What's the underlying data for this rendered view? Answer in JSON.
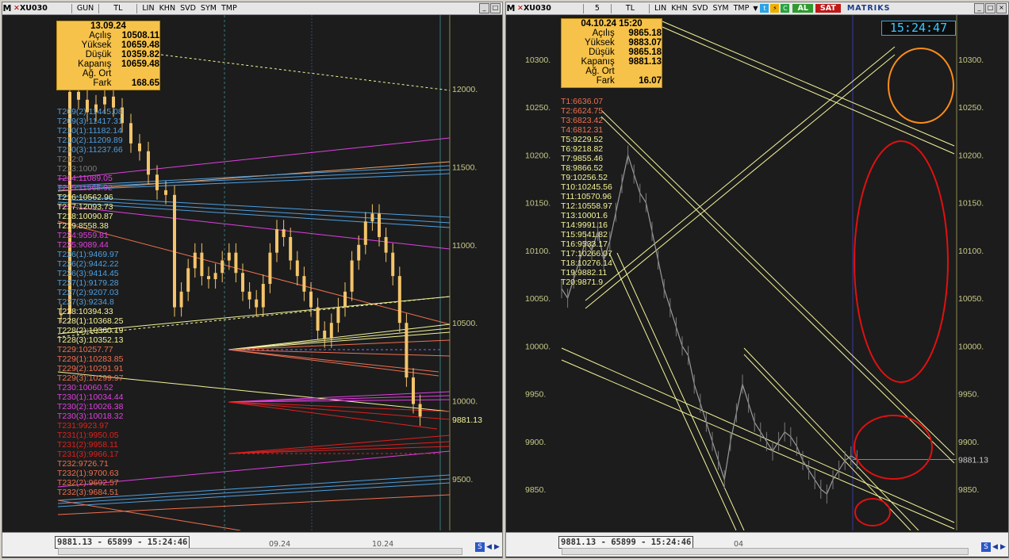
{
  "left": {
    "toolbar": {
      "symbol": "XU030",
      "buttons": [
        "GUN",
        "TL",
        "LIN",
        "KHN",
        "SVD",
        "SYM",
        "TMP"
      ]
    },
    "info": {
      "date": "13.09.24",
      "rows": [
        {
          "k": "Açılış",
          "v": "10508.11"
        },
        {
          "k": "Yüksek",
          "v": "10659.48"
        },
        {
          "k": "Düşük",
          "v": "10359.82"
        },
        {
          "k": "Kapanış",
          "v": "10659.48"
        },
        {
          "k": "Ağ. Ort",
          "v": ""
        },
        {
          "k": "Fark",
          "v": "168.65"
        }
      ]
    },
    "levels": [
      {
        "t": "T209(2):11445.08",
        "c": "#4f9fdf"
      },
      {
        "t": "T209(3):11417.31",
        "c": "#4f9fdf"
      },
      {
        "t": "T210(1):11182.14",
        "c": "#4f9fdf"
      },
      {
        "t": "T210(2):11209.89",
        "c": "#4f9fdf"
      },
      {
        "t": "T210(3):11237.66",
        "c": "#4f9fdf"
      },
      {
        "t": "T212:0",
        "c": "#7a7a7a"
      },
      {
        "t": "T213:1000",
        "c": "#7a7a7a"
      },
      {
        "t": "T214:11089.05",
        "c": "#e040e0"
      },
      {
        "t": "T215:11565.92",
        "c": "#e040e0"
      },
      {
        "t": "T216:10562.96",
        "c": "#f4f49a"
      },
      {
        "t": "T217:12093.73",
        "c": "#f4f49a"
      },
      {
        "t": "T218:10090.87",
        "c": "#f4f49a"
      },
      {
        "t": "T219:8558.38",
        "c": "#f4f49a"
      },
      {
        "t": "T224:9559.81",
        "c": "#e040e0"
      },
      {
        "t": "T225:9089.44",
        "c": "#e040e0"
      },
      {
        "t": "T226(1):9469.97",
        "c": "#4f9fdf"
      },
      {
        "t": "T226(2):9442.22",
        "c": "#4f9fdf"
      },
      {
        "t": "T226(3):9414.45",
        "c": "#4f9fdf"
      },
      {
        "t": "T227(1):9179.28",
        "c": "#4f9fdf"
      },
      {
        "t": "T227(2):9207.03",
        "c": "#4f9fdf"
      },
      {
        "t": "T227(3):9234.8",
        "c": "#4f9fdf"
      },
      {
        "t": "T228:10394.33",
        "c": "#f4f49a"
      },
      {
        "t": "T228(1):10368.25",
        "c": "#f4f49a"
      },
      {
        "t": "T228(2):10360.19",
        "c": "#f4f49a"
      },
      {
        "t": "T228(3):10352.13",
        "c": "#f4f49a"
      },
      {
        "t": "T229:10257.77",
        "c": "#f07050"
      },
      {
        "t": "T229(1):10283.85",
        "c": "#f07050"
      },
      {
        "t": "T229(2):10291.91",
        "c": "#f07050"
      },
      {
        "t": "T229(3):10299.97",
        "c": "#f07050"
      },
      {
        "t": "T230:10060.52",
        "c": "#e040e0"
      },
      {
        "t": "T230(1):10034.44",
        "c": "#e040e0"
      },
      {
        "t": "T230(2):10026.38",
        "c": "#e040e0"
      },
      {
        "t": "T230(3):10018.32",
        "c": "#e040e0"
      },
      {
        "t": "T231:9923.97",
        "c": "#e02020"
      },
      {
        "t": "T231(1):9950.05",
        "c": "#e02020"
      },
      {
        "t": "T231(2):9958.11",
        "c": "#e02020"
      },
      {
        "t": "T231(3):9966.17",
        "c": "#e02020"
      },
      {
        "t": "T232:9726.71",
        "c": "#f07050"
      },
      {
        "t": "T232(1):9700.63",
        "c": "#f07050"
      },
      {
        "t": "T232(2):9692.57",
        "c": "#f07050"
      },
      {
        "t": "T232(3):9684.51",
        "c": "#f07050"
      }
    ],
    "price_axis": [
      "12000.",
      "11500.",
      "11000.",
      "10500.",
      "10000.",
      "9500."
    ],
    "last_price": "9881.13",
    "status": "9881.13 - 65899 - 15:24:46",
    "date_labels": [
      "09.24",
      "10.24"
    ]
  },
  "right": {
    "toolbar": {
      "symbol": "XU030",
      "period": "5",
      "currency": "TL",
      "buttons": [
        "LIN",
        "KHN",
        "SVD",
        "SYM",
        "TMP"
      ],
      "buy": "AL",
      "sell": "SAT",
      "brand": "MATRIKS"
    },
    "clock": "15:24:47",
    "info": {
      "date": "04.10.24 15:20",
      "rows": [
        {
          "k": "Açılış",
          "v": "9865.18"
        },
        {
          "k": "Yüksek",
          "v": "9883.07"
        },
        {
          "k": "Düşük",
          "v": "9865.18"
        },
        {
          "k": "Kapanış",
          "v": "9881.13"
        },
        {
          "k": "Ağ. Ort",
          "v": ""
        },
        {
          "k": "Fark",
          "v": "16.07"
        }
      ]
    },
    "levels": [
      {
        "t": "T1:6636.07",
        "c": "#f07050"
      },
      {
        "t": "T2:6624.75",
        "c": "#f07050"
      },
      {
        "t": "T3:6823.42",
        "c": "#f07050"
      },
      {
        "t": "T4:6812.31",
        "c": "#f07050"
      },
      {
        "t": "T5:9229.52",
        "c": "#f4f49a"
      },
      {
        "t": "T6:9218.82",
        "c": "#f4f49a"
      },
      {
        "t": "T7:9855.46",
        "c": "#f4f49a"
      },
      {
        "t": "T8:9866.52",
        "c": "#f4f49a"
      },
      {
        "t": "T9:10256.52",
        "c": "#f4f49a"
      },
      {
        "t": "T10:10245.56",
        "c": "#f4f49a"
      },
      {
        "t": "T11:10570.96",
        "c": "#f4f49a"
      },
      {
        "t": "T12:10558.97",
        "c": "#f4f49a"
      },
      {
        "t": "T13:10001.6",
        "c": "#f4f49a"
      },
      {
        "t": "T14:9991.16",
        "c": "#f4f49a"
      },
      {
        "t": "T15:9541.82",
        "c": "#f4f49a"
      },
      {
        "t": "T16:9533.17",
        "c": "#f4f49a"
      },
      {
        "t": "T17:10266.07",
        "c": "#f4f49a"
      },
      {
        "t": "T18:10276.14",
        "c": "#f4f49a"
      },
      {
        "t": "T19:9882.11",
        "c": "#f4f49a"
      },
      {
        "t": "T20:9871.9",
        "c": "#f4f49a"
      }
    ],
    "price_axis": [
      "10300.",
      "10250.",
      "10200.",
      "10150.",
      "10100.",
      "10050.",
      "10000.",
      "9950.",
      "9900.",
      "9850."
    ],
    "last_price": "9881.13",
    "status": "9881.13 - 65899 - 15:24:46",
    "date_labels": [
      "04"
    ]
  },
  "colors": {
    "panel_bg": "#1c1c1c",
    "candle": "#f3c46a",
    "info_bg": "#f6c24a",
    "trend_yellow": "#f4f49a",
    "ellipse_orange": "#ff8c1a",
    "ellipse_red": "#e01010"
  }
}
